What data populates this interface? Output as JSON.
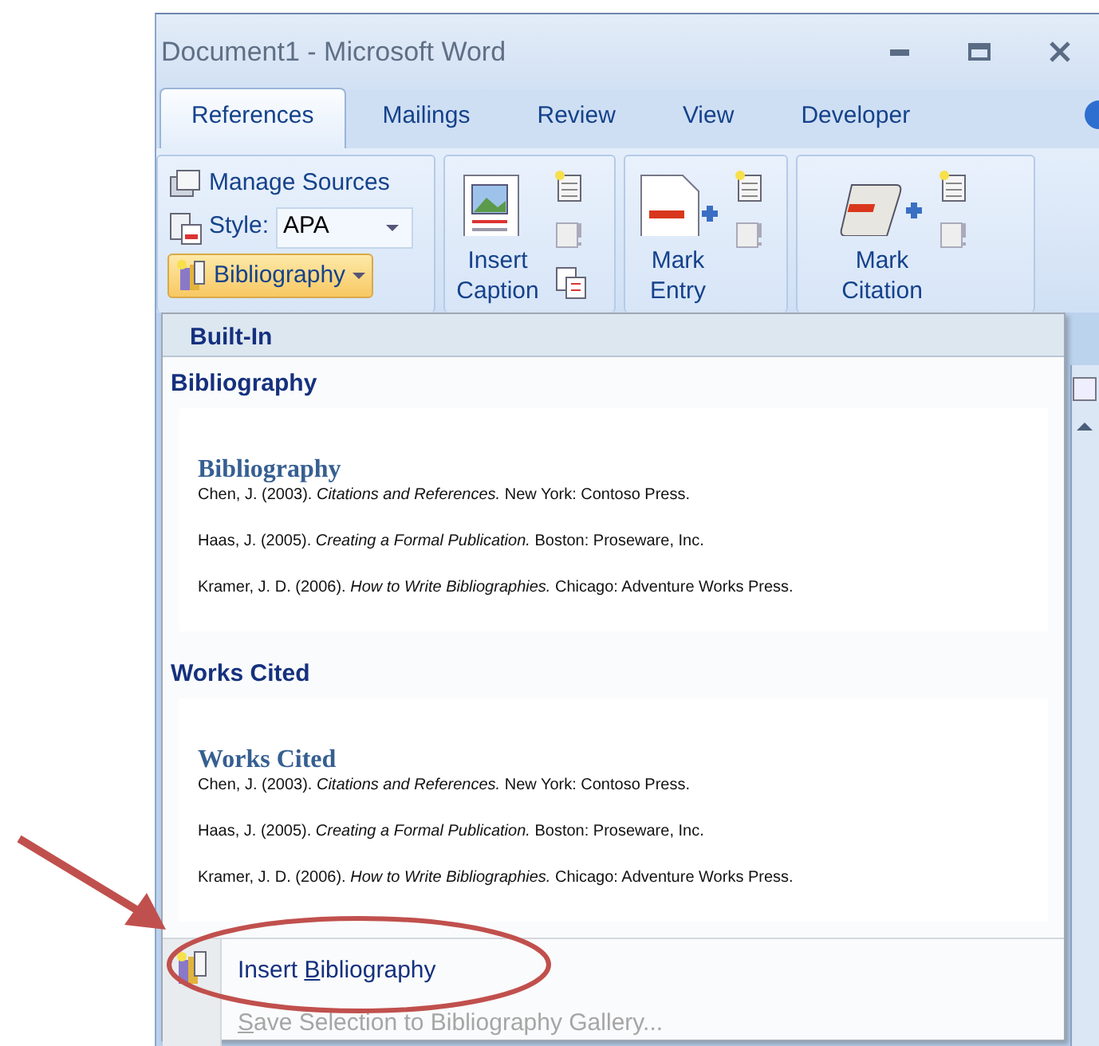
{
  "window": {
    "title": "Document1 - Microsoft Word"
  },
  "tabs": [
    {
      "label": "References",
      "selected": true
    },
    {
      "label": "Mailings",
      "selected": false
    },
    {
      "label": "Review",
      "selected": false
    },
    {
      "label": "View",
      "selected": false
    },
    {
      "label": "Developer",
      "selected": false
    }
  ],
  "ribbon": {
    "manage_sources": "Manage Sources",
    "style_label": "Style:",
    "style_value": "APA",
    "bibliography_button": {
      "label": "Bibliography",
      "expanded": true
    },
    "big_buttons": [
      {
        "kind": "caption",
        "line1": "Insert",
        "line2": "Caption"
      },
      {
        "kind": "entry",
        "line1": "Mark",
        "line2": "Entry"
      },
      {
        "kind": "citation",
        "line1": "Mark",
        "line2": "Citation"
      }
    ]
  },
  "menu": {
    "header": "Built-In",
    "sections": [
      {
        "title": "Bibliography",
        "preview_heading": "Bibliography",
        "entries": [
          "Chen, J. (2003). *Citations and References.* New York: Contoso Press.",
          "Haas, J. (2005). *Creating a Formal Publication.* Boston: Proseware, Inc.",
          "Kramer, J. D. (2006). *How to Write Bibliographies.* Chicago: Adventure Works Press."
        ]
      },
      {
        "title": "Works Cited",
        "preview_heading": "Works Cited",
        "entries": [
          "Chen, J. (2003). *Citations and References.* New York: Contoso Press.",
          "Haas, J. (2005). *Creating a Formal Publication.* Boston: Proseware, Inc.",
          "Kramer, J. D. (2006). *How to Write Bibliographies.* Chicago: Adventure Works Press."
        ]
      }
    ],
    "commands": [
      {
        "before": "Insert ",
        "key": "B",
        "after": "ibliography",
        "disabled": false
      },
      {
        "key": "S",
        "after": "ave Selection to Bibliography Gallery...",
        "disabled": true
      }
    ]
  }
}
